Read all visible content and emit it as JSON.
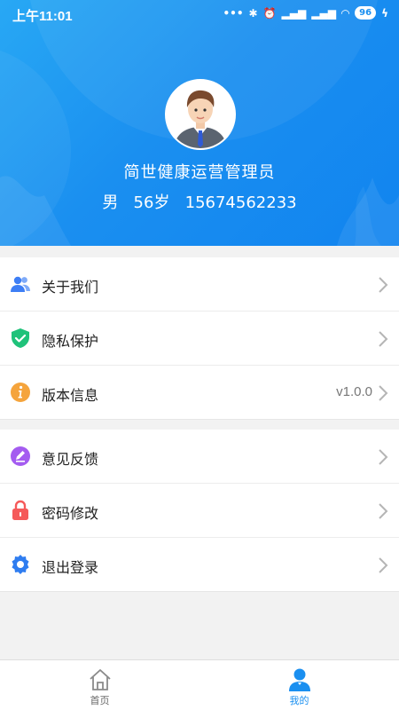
{
  "status_bar": {
    "time": "上午11:01",
    "battery": "96",
    "icons": [
      "dots-icon",
      "bluetooth-icon",
      "alarm-icon",
      "signal-icon",
      "signal-icon",
      "wifi-icon",
      "battery-icon",
      "charging-icon"
    ]
  },
  "profile": {
    "name": "简世健康运营管理员",
    "gender": "男",
    "age": "56岁",
    "phone": "15674562233"
  },
  "menu_group_1": [
    {
      "label": "关于我们",
      "icon": "users-icon",
      "color": "#3d7ef5"
    },
    {
      "label": "隐私保护",
      "icon": "shield-check-icon",
      "color": "#1fc27a"
    },
    {
      "label": "版本信息",
      "icon": "info-icon",
      "color": "#f5a43c",
      "value": "v1.0.0"
    }
  ],
  "menu_group_2": [
    {
      "label": "意见反馈",
      "icon": "edit-icon",
      "color": "#a45cf0"
    },
    {
      "label": "密码修改",
      "icon": "lock-icon",
      "color": "#f55a5a"
    },
    {
      "label": "退出登录",
      "icon": "gear-icon",
      "color": "#2f7df0"
    }
  ],
  "tabbar": {
    "home_label": "首页",
    "mine_label": "我的",
    "accent": "#1a8ff0"
  }
}
